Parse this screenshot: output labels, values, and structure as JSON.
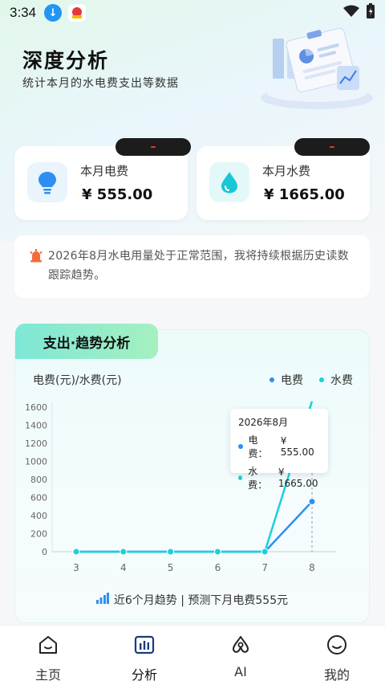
{
  "status_bar": {
    "time": "3:34"
  },
  "header": {
    "title": "深度分析",
    "subtitle": "统计本月的水电费支出等数据"
  },
  "bills": {
    "electric": {
      "label": "本月电费",
      "amount": "¥ 555.00",
      "badge": "–",
      "icon": "lightbulb-icon",
      "color": "#2e8ff0"
    },
    "water": {
      "label": "本月水费",
      "amount": "¥ 1665.00",
      "badge": "–",
      "icon": "water-drop-icon",
      "color": "#19c6d6"
    }
  },
  "notice": {
    "text": "2026年8月水电用量处于正常范围，我将持续根据历史读数跟踪趋势。",
    "icon": "alarm-icon"
  },
  "trend": {
    "tab_title": "支出·趋势分析",
    "y_axis_title": "电费(元)/水费(元)",
    "legend": [
      {
        "name": "电费",
        "color": "#2e8ff0"
      },
      {
        "name": "水费",
        "color": "#19d0dc"
      }
    ],
    "tooltip": {
      "title": "2026年8月",
      "rows": [
        {
          "label": "电费：",
          "value": "¥ 555.00",
          "color": "#2e8ff0"
        },
        {
          "label": "水费：",
          "value": "¥ 1665.00",
          "color": "#19d0dc"
        }
      ]
    },
    "footer": "近6个月趋势 | 预测下月电费555元"
  },
  "chart_data": {
    "type": "line",
    "categories": [
      "3",
      "4",
      "5",
      "6",
      "7",
      "8"
    ],
    "ylabel": "电费(元)/水费(元)",
    "yticks_visible": [
      "0",
      "200",
      "400",
      "600",
      "800",
      "1000",
      "1200",
      "1400",
      "1600"
    ],
    "ylim": [
      0,
      1600
    ],
    "series": [
      {
        "name": "电费",
        "values": [
          0,
          0,
          0,
          0,
          0,
          555
        ],
        "color": "#2e8ff0"
      },
      {
        "name": "水费",
        "values": [
          0,
          0,
          0,
          0,
          0,
          1665
        ],
        "color": "#19d0dc"
      }
    ]
  },
  "bottom_nav": [
    {
      "label": "主页",
      "icon": "home-icon",
      "active": false
    },
    {
      "label": "分析",
      "icon": "analytics-icon",
      "active": true
    },
    {
      "label": "AI",
      "icon": "ai-icon",
      "active": false
    },
    {
      "label": "我的",
      "icon": "profile-icon",
      "active": false
    }
  ]
}
